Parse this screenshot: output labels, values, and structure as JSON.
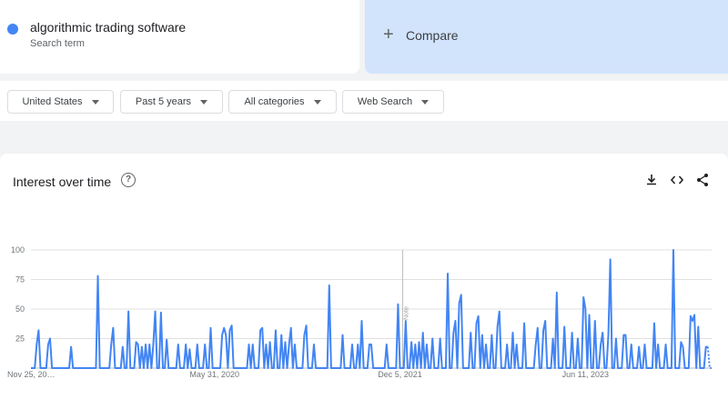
{
  "term": {
    "name": "algorithmic trading software",
    "sub": "Search term",
    "color": "#4285f4"
  },
  "compare": {
    "label": "Compare",
    "icon": "plus-icon"
  },
  "filters": {
    "region": "United States",
    "period": "Past 5 years",
    "category": "All categories",
    "property": "Web Search"
  },
  "chart_section": {
    "title": "Interest over time",
    "icons": [
      "help-icon",
      "download-icon",
      "embed-icon",
      "share-icon"
    ]
  },
  "chart_data": {
    "type": "line",
    "title": "Interest over time",
    "xlabel": "",
    "ylabel": "",
    "ylim": [
      0,
      100
    ],
    "yticks": [
      25,
      50,
      75,
      100
    ],
    "grid": true,
    "x_tick_labels": [
      "Nov 25, 20…",
      "May 31, 2020",
      "Dec 5, 2021",
      "Jun 11, 2023"
    ],
    "annotation": "Note",
    "series": [
      {
        "color": "#4285f4",
        "values": [
          0,
          0,
          0,
          20,
          32,
          0,
          0,
          0,
          0,
          20,
          25,
          0,
          0,
          0,
          0,
          0,
          0,
          0,
          0,
          0,
          0,
          18,
          0,
          0,
          0,
          0,
          0,
          0,
          0,
          0,
          0,
          0,
          0,
          0,
          0,
          78,
          0,
          0,
          0,
          0,
          0,
          0,
          20,
          34,
          0,
          0,
          0,
          0,
          18,
          0,
          0,
          48,
          0,
          0,
          0,
          22,
          20,
          0,
          18,
          0,
          20,
          0,
          20,
          0,
          20,
          48,
          0,
          0,
          47,
          0,
          0,
          24,
          0,
          0,
          0,
          0,
          0,
          20,
          0,
          0,
          0,
          20,
          0,
          16,
          0,
          0,
          0,
          20,
          0,
          0,
          0,
          20,
          0,
          0,
          34,
          0,
          0,
          0,
          0,
          0,
          28,
          34,
          28,
          0,
          32,
          36,
          0,
          0,
          0,
          0,
          0,
          0,
          0,
          0,
          20,
          0,
          20,
          0,
          0,
          0,
          32,
          34,
          0,
          20,
          0,
          22,
          0,
          0,
          32,
          0,
          0,
          28,
          0,
          22,
          0,
          20,
          34,
          0,
          20,
          0,
          0,
          0,
          0,
          28,
          36,
          0,
          0,
          0,
          20,
          0,
          0,
          0,
          0,
          0,
          0,
          0,
          70,
          0,
          0,
          0,
          0,
          0,
          0,
          28,
          0,
          0,
          0,
          0,
          20,
          0,
          0,
          20,
          0,
          40,
          0,
          0,
          0,
          20,
          20,
          0,
          0,
          0,
          0,
          0,
          0,
          0,
          20,
          0,
          0,
          0,
          0,
          0,
          54,
          0,
          0,
          0,
          40,
          0,
          0,
          22,
          0,
          20,
          0,
          22,
          0,
          30,
          0,
          20,
          0,
          0,
          25,
          0,
          0,
          0,
          25,
          0,
          0,
          0,
          80,
          0,
          0,
          30,
          40,
          0,
          55,
          62,
          0,
          0,
          0,
          0,
          30,
          0,
          0,
          38,
          44,
          0,
          28,
          0,
          20,
          0,
          0,
          28,
          0,
          0,
          35,
          48,
          0,
          0,
          0,
          20,
          0,
          0,
          30,
          0,
          20,
          0,
          0,
          0,
          38,
          0,
          0,
          0,
          0,
          0,
          20,
          34,
          0,
          0,
          32,
          40,
          0,
          0,
          0,
          25,
          0,
          64,
          0,
          0,
          0,
          35,
          0,
          0,
          0,
          30,
          0,
          0,
          25,
          0,
          0,
          60,
          50,
          0,
          45,
          0,
          0,
          40,
          0,
          0,
          20,
          30,
          0,
          0,
          28,
          92,
          0,
          0,
          25,
          0,
          0,
          0,
          28,
          28,
          0,
          0,
          20,
          0,
          0,
          0,
          18,
          0,
          0,
          20,
          0,
          0,
          0,
          0,
          38,
          0,
          20,
          0,
          0,
          0,
          20,
          0,
          0,
          0,
          100,
          0,
          0,
          0,
          22,
          18,
          0,
          0,
          0,
          44,
          40,
          45,
          0,
          35,
          0,
          0,
          0,
          18,
          18,
          0,
          0
        ]
      }
    ]
  }
}
